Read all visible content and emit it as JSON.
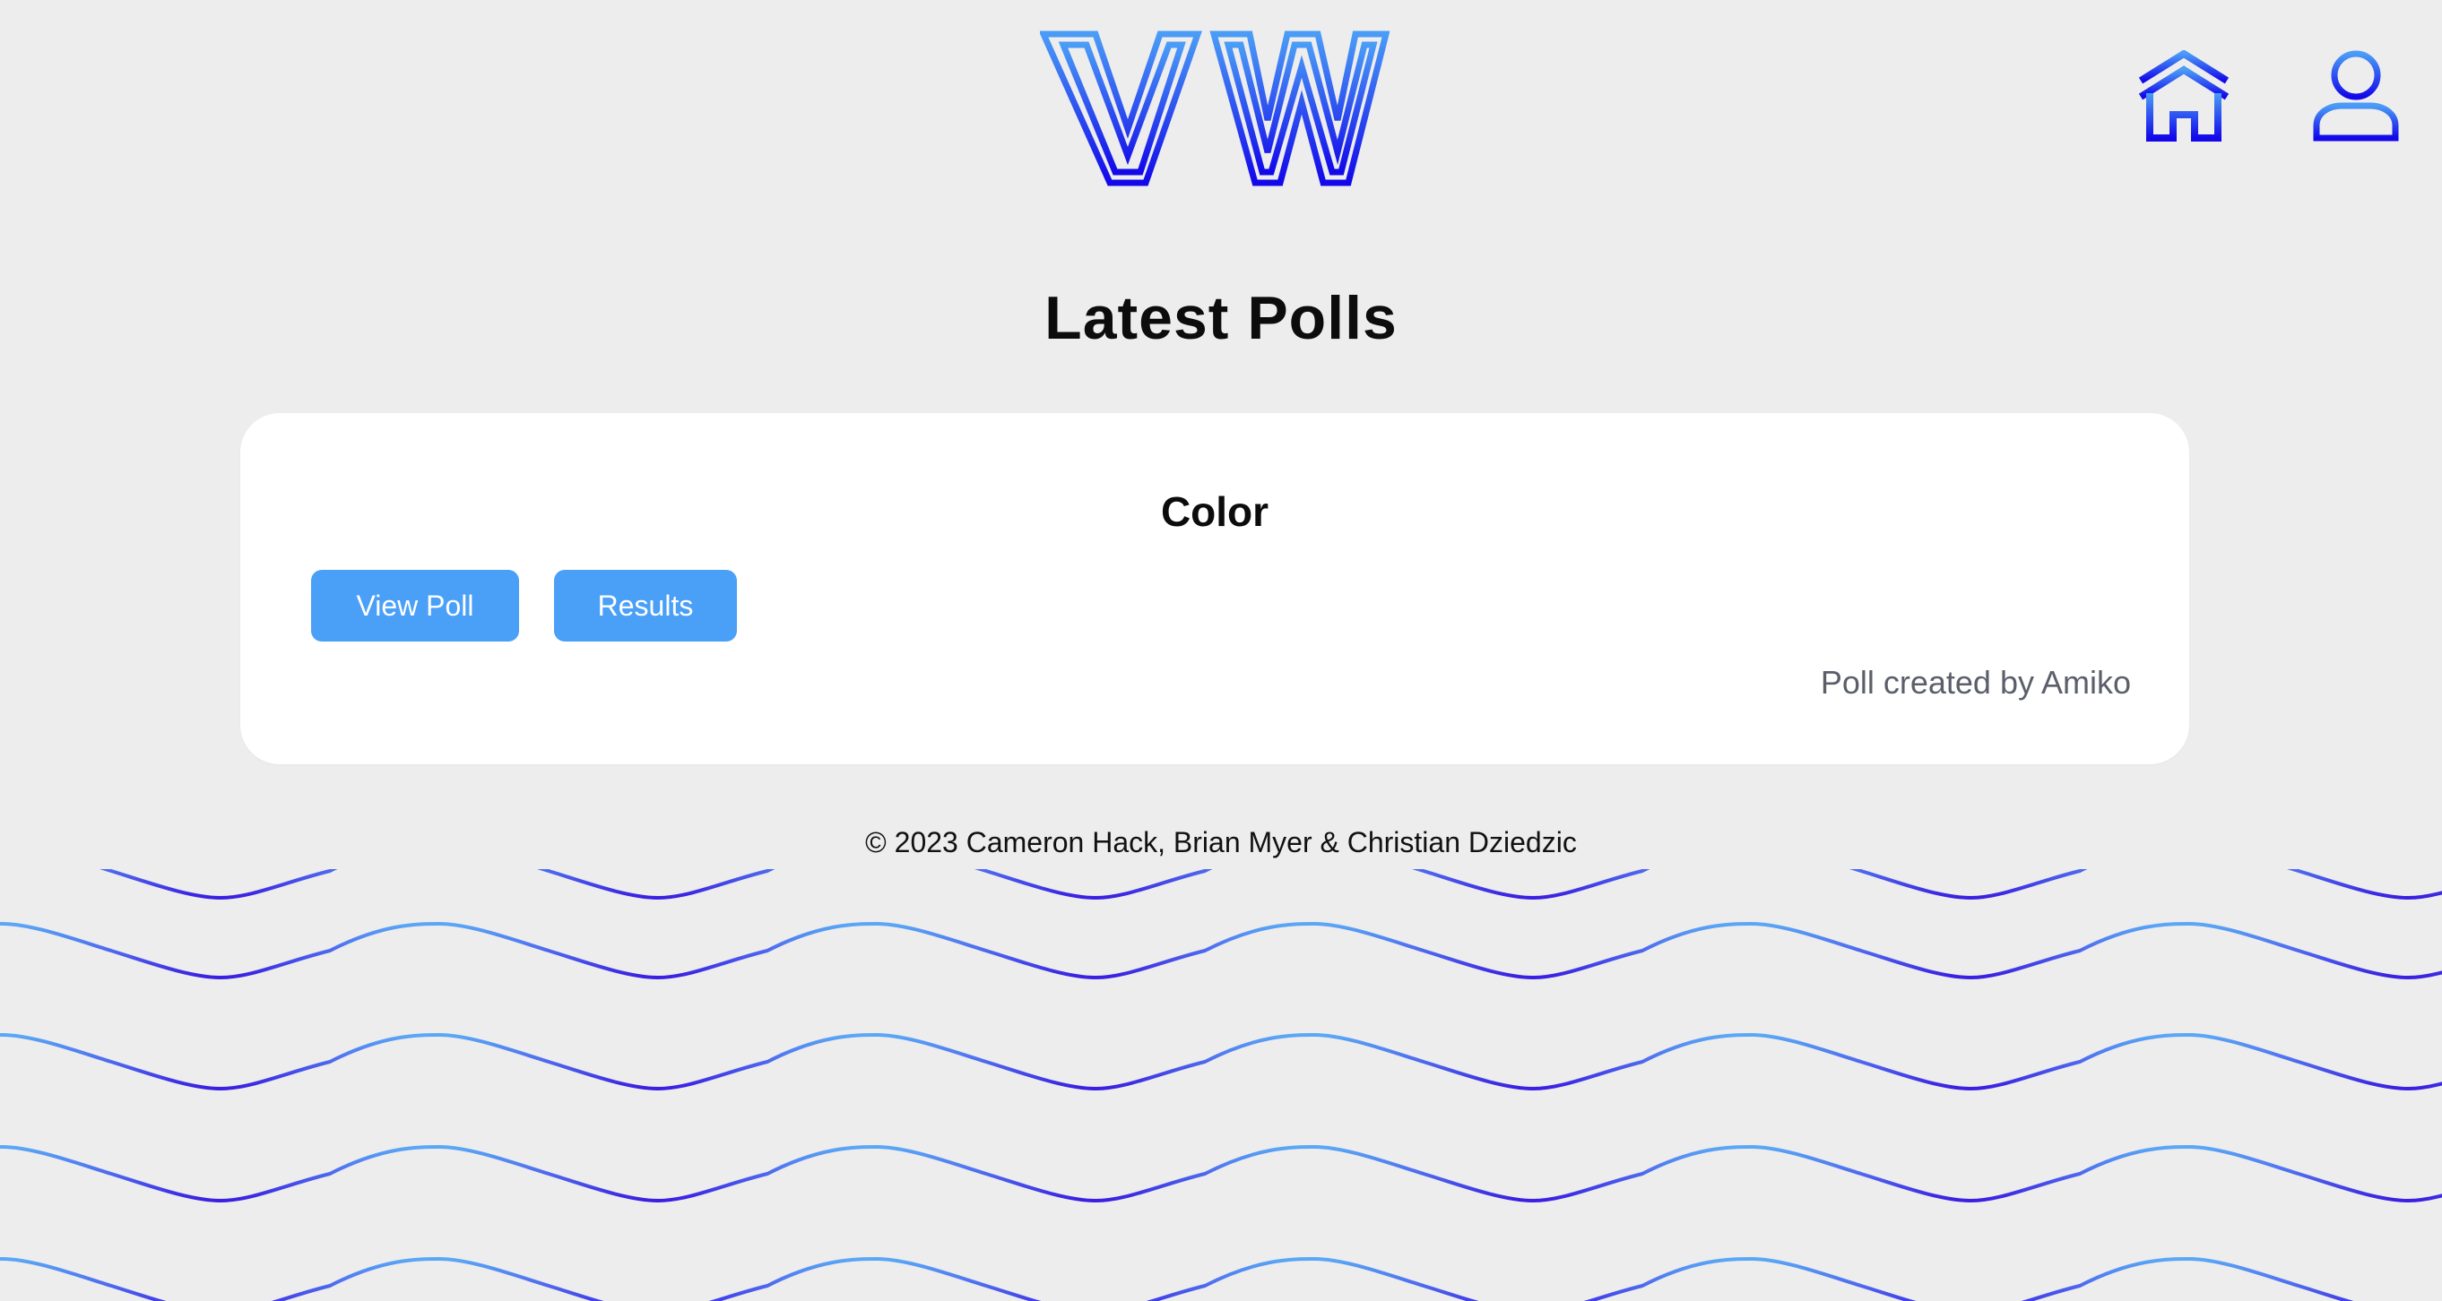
{
  "header": {
    "logo_text": "VW",
    "home_icon": "home-icon",
    "profile_icon": "user-icon"
  },
  "page": {
    "title": "Latest Polls"
  },
  "polls": [
    {
      "title": "Color",
      "view_label": "View Poll",
      "results_label": "Results",
      "author_text": "Poll created by Amiko"
    }
  ],
  "footer": {
    "text": "© 2023 Cameron Hack, Brian Myer & Christian Dziedzic"
  },
  "colors": {
    "background": "#ededee",
    "accent_button": "#4aa0f7",
    "gradient_top": "#3f8ff5",
    "gradient_bottom": "#1a0fe6",
    "card": "#ffffff"
  }
}
